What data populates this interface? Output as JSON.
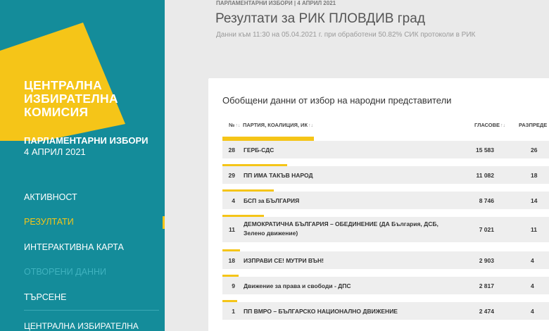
{
  "sidebar": {
    "logo_lines": [
      "ЦЕНТРАЛНА",
      "ИЗБИРАТЕЛНА",
      "КОМИСИЯ"
    ],
    "election_title": "ПАРЛАМЕНТАРНИ ИЗБОРИ",
    "election_date": "4 АПРИЛ 2021",
    "nav": [
      {
        "label": "АКТИВНОСТ",
        "state": "normal"
      },
      {
        "label": "РЕЗУЛТАТИ",
        "state": "active"
      },
      {
        "label": "ИНТЕРАКТИВНА КАРТА",
        "state": "normal"
      },
      {
        "label": "ОТВОРЕНИ ДАННИ",
        "state": "disabled"
      },
      {
        "label": "ТЪРСЕНЕ",
        "state": "normal"
      }
    ],
    "footer": "ЦЕНТРАЛНА ИЗБИРАТЕЛНА",
    "colors": {
      "background": "#148c9a",
      "accent": "#f5c518"
    }
  },
  "header": {
    "breadcrumb": "ПАРЛАМЕНТАРНИ ИЗБОРИ | 4 АПРИЛ 2021",
    "title": "Резултати за РИК ПЛОВДИВ град",
    "subtitle": "Данни към 11:30 на 05.04.2021 г. при обработени 50.82% СИК протоколи в РИК"
  },
  "card": {
    "title": "Обобщени данни от избор на народни представители",
    "columns": {
      "num": "№",
      "party": "ПАРТИЯ, КОАЛИЦИЯ, ИК",
      "votes": "ГЛАСОВЕ",
      "dist": "РАЗПРЕДЕ"
    },
    "sort_glyph": "↑↓",
    "rows": [
      {
        "num": "28",
        "name": "ГЕРБ-СДС",
        "votes": "15 583",
        "dist": "26",
        "bar": 1.0
      },
      {
        "num": "29",
        "name": "ПП ИМА ТАКЪВ НАРОД",
        "votes": "11 082",
        "dist": "18",
        "bar": 0.71
      },
      {
        "num": "4",
        "name": "БСП за БЪЛГАРИЯ",
        "votes": "8 746",
        "dist": "14",
        "bar": 0.56
      },
      {
        "num": "11",
        "name": "ДЕМОКРАТИЧНА БЪЛГАРИЯ – ОБЕДИНЕНИЕ (ДА България, ДСБ, Зелено движение)",
        "votes": "7 021",
        "dist": "11",
        "bar": 0.45
      },
      {
        "num": "18",
        "name": "ИЗПРАВИ СЕ! МУТРИ ВЪН!",
        "votes": "2 903",
        "dist": "4",
        "bar": 0.19
      },
      {
        "num": "9",
        "name": "Движение за права и свободи - ДПС",
        "votes": "2 817",
        "dist": "4",
        "bar": 0.18
      },
      {
        "num": "1",
        "name": "ПП ВМРО – БЪЛГАРСКО НАЦИОНАЛНО ДВИЖЕНИЕ",
        "votes": "2 474",
        "dist": "4",
        "bar": 0.16
      }
    ]
  }
}
